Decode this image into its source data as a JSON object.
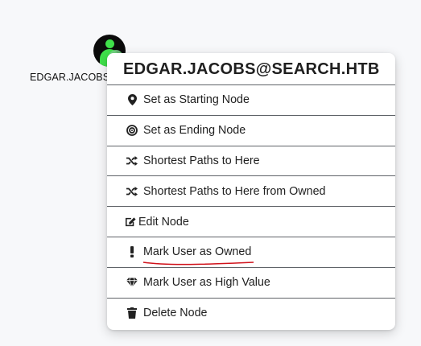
{
  "node": {
    "label": "EDGAR.JACOBS@SEARCH.HTB",
    "icon": "user-icon",
    "status": "owned"
  },
  "menu": {
    "title": "EDGAR.JACOBS@SEARCH.HTB",
    "items": [
      {
        "label": "Set as Starting Node",
        "icon": "map-marker-icon"
      },
      {
        "label": "Set as Ending Node",
        "icon": "target-icon"
      },
      {
        "label": "Shortest Paths to Here",
        "icon": "random-icon"
      },
      {
        "label": "Shortest Paths to Here from Owned",
        "icon": "random-icon"
      },
      {
        "label": "Edit Node",
        "icon": "edit-icon"
      },
      {
        "label": "Mark User as Owned",
        "icon": "exclamation-icon"
      },
      {
        "label": "Mark User as High Value",
        "icon": "gem-icon"
      },
      {
        "label": "Delete Node",
        "icon": "trash-icon"
      }
    ]
  },
  "colors": {
    "node_fill": "#0b0b0b",
    "user_glyph": "#3fe04a",
    "annotation_underline": "#d0121b"
  }
}
